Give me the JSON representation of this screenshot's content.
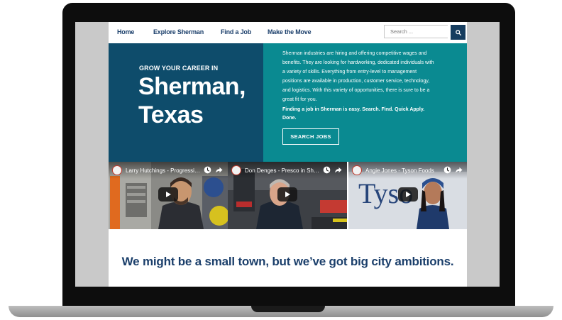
{
  "nav": {
    "items": [
      {
        "label": "Home"
      },
      {
        "label": "Explore Sherman"
      },
      {
        "label": "Find a Job"
      },
      {
        "label": "Make the Move"
      }
    ],
    "search_placeholder": "Search ..."
  },
  "hero": {
    "kicker": "GROW YOUR CAREER IN",
    "city": "Sherman,",
    "state": "Texas",
    "body": "Sherman industries are hiring and offering competitive wages and benefits. They are looking for hardworking, dedicated individuals with a variety of skills. Everything from entry-level to management positions are available in production, customer service, technology, and logistics. With this variety of opportunities, there is sure to be a great fit for you.",
    "cta": "Finding a job in Sherman is easy. Search. Find. Quick Apply. Done.",
    "button_label": "SEARCH JOBS"
  },
  "videos": [
    {
      "title": "Larry Hutchings - Progressive..."
    },
    {
      "title": "Don Denges - Presco in Sherman"
    },
    {
      "title": "Angie Jones - Tyson Foods"
    }
  ],
  "tagline": "We might be a small town, but we’ve got big city ambitions.",
  "colors": {
    "nav_text": "#1b3f6b",
    "hero_left_bg": "#0e4c6b",
    "hero_right_bg": "#0a8a91",
    "search_button_bg": "#163d5f"
  }
}
